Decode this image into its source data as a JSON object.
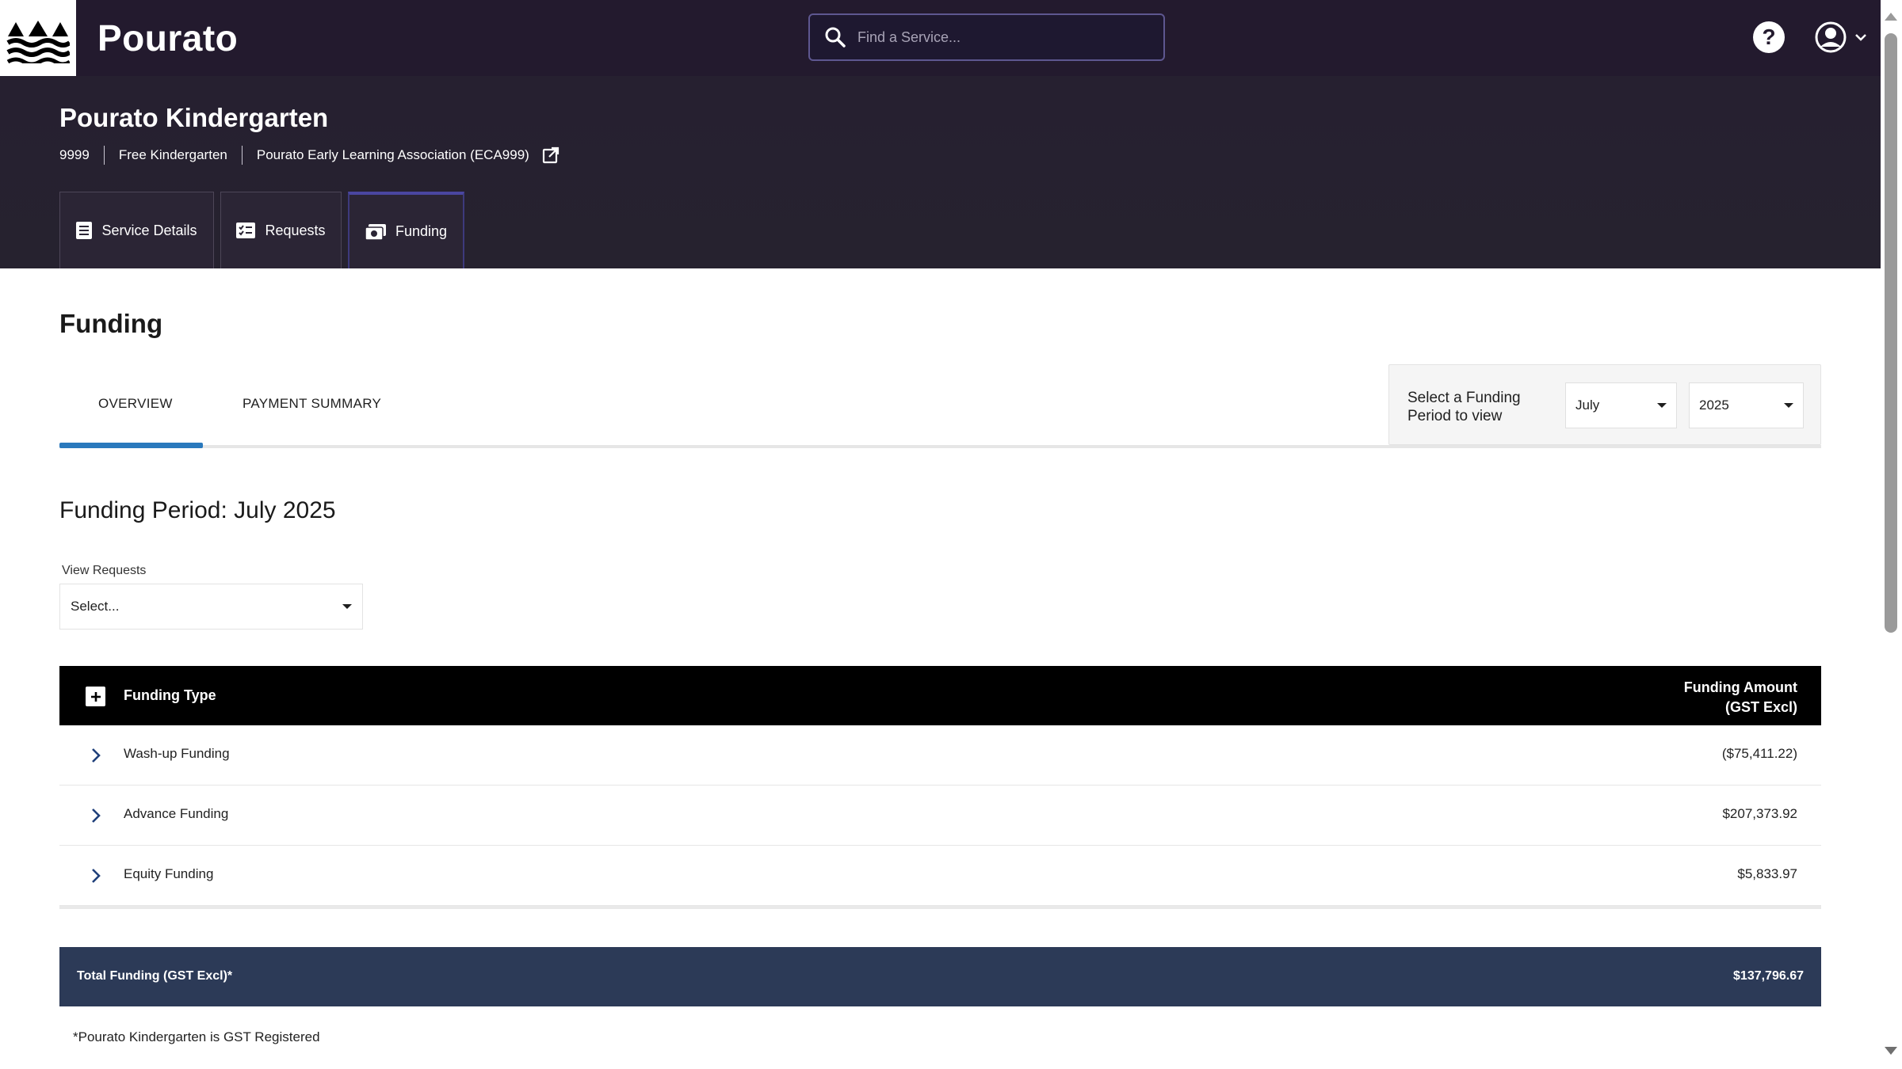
{
  "header": {
    "brand": "Pourato",
    "search_placeholder": "Find a Service...",
    "help_label": "?"
  },
  "service": {
    "name": "Pourato Kindergarten",
    "id": "9999",
    "type": "Free Kindergarten",
    "association": "Pourato Early Learning Association (ECA999)"
  },
  "tabs": [
    {
      "label": "Service Details",
      "icon": "list-icon"
    },
    {
      "label": "Requests",
      "icon": "checklist-icon"
    },
    {
      "label": "Funding",
      "icon": "money-icon",
      "active": true
    }
  ],
  "funding": {
    "title": "Funding",
    "subtabs": [
      {
        "label": "OVERVIEW",
        "active": true
      },
      {
        "label": "PAYMENT SUMMARY"
      }
    ],
    "period_selector": {
      "label": "Select a Funding Period to view",
      "month": "July",
      "year": "2025"
    },
    "period_title": "Funding Period: July 2025",
    "view_requests_label": "View Requests",
    "view_requests_value": "Select...",
    "table": {
      "col_type": "Funding Type",
      "col_amount_line1": "Funding Amount",
      "col_amount_line2": "(GST Excl)",
      "rows": [
        {
          "type": "Wash-up Funding",
          "amount": "($75,411.22)"
        },
        {
          "type": "Advance Funding",
          "amount": "$207,373.92"
        },
        {
          "type": "Equity Funding",
          "amount": "$5,833.97"
        }
      ]
    },
    "total_label": "Total Funding (GST Excl)*",
    "total_amount": "$137,796.67",
    "gst_note": "*Pourato Kindergarten is GST Registered"
  },
  "colors": {
    "header_bg": "#231a2e",
    "accent_blue": "#2a79bd",
    "total_bar": "#2c3a57"
  }
}
